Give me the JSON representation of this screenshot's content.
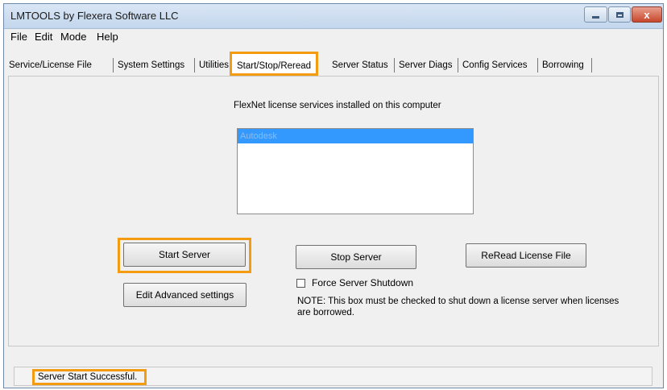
{
  "window": {
    "title": "LMTOOLS by Flexera Software LLC",
    "close_glyph": "x"
  },
  "menu": [
    "File",
    "Edit",
    "Mode",
    "Help"
  ],
  "tabs": [
    {
      "label": "Service/License File"
    },
    {
      "label": "System Settings"
    },
    {
      "label": "Utilities"
    },
    {
      "label": "Start/Stop/Reread",
      "active": true
    },
    {
      "label": "Server Status"
    },
    {
      "label": "Server Diags"
    },
    {
      "label": "Config Services"
    },
    {
      "label": "Borrowing"
    }
  ],
  "panel": {
    "caption": "FlexNet license services installed on this computer",
    "services": [
      "Autodesk"
    ],
    "buttons": {
      "start": "Start Server",
      "stop": "Stop Server",
      "reread": "ReRead License File",
      "advanced": "Edit Advanced settings"
    },
    "force_shutdown": {
      "label": "Force Server Shutdown",
      "checked": false
    },
    "note": "NOTE:  This box must be checked to shut down a license server when licenses are borrowed."
  },
  "status": {
    "text": "Server Start Successful."
  },
  "colors": {
    "highlight": "#f39c12",
    "selection": "#3399ff"
  }
}
